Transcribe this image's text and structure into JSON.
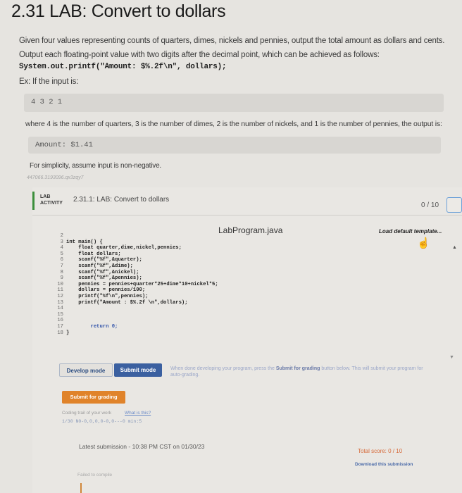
{
  "page": {
    "title": "2.31 LAB: Convert to dollars"
  },
  "description": {
    "line1": "Given four values representing counts of quarters, dimes, nickels and pennies, output the total amount as dollars and cents.",
    "line2": "Output each floating-point value with two digits after the decimal point, which can be achieved as follows:",
    "code_sample": "System.out.printf(\"Amount: $%.2f\\n\", dollars);",
    "example_intro": "Ex: If the input is:",
    "example_input": "4 3 2 1",
    "where_text": "where 4 is the number of quarters, 3 is the number of dimes, 2 is the number of nickels, and 1 is the number of pennies, the output is:",
    "example_output": "Amount: $1.41",
    "simplicity": "For simplicity, assume input is non-negative.",
    "hash_id": "447066.3193096.qx3zqy7"
  },
  "activity": {
    "badge_line1": "LAB",
    "badge_line2": "ACTIVITY",
    "title": "2.31.1: LAB: Convert to dollars",
    "score": "0 / 10"
  },
  "editor": {
    "file_name": "LabProgram.java",
    "load_default": "Load default template...",
    "lines": [
      {
        "n": "2",
        "code": ""
      },
      {
        "n": "3",
        "code": "int main() {"
      },
      {
        "n": "4",
        "code": "    float quarter,dime,nickel,pennies;"
      },
      {
        "n": "5",
        "code": "    float dollars;"
      },
      {
        "n": "6",
        "code": "    scanf(\"%f\",&quarter);"
      },
      {
        "n": "7",
        "code": "    scanf(\"%f\",&dime);"
      },
      {
        "n": "8",
        "code": "    scanf(\"%f\",&nickel);"
      },
      {
        "n": "9",
        "code": "    scanf(\"%f\",&pennies);"
      },
      {
        "n": "10",
        "code": "    pennies = pennies+quarter*25+dime*10+nickel*5;"
      },
      {
        "n": "11",
        "code": "    dollars = pennies/100;"
      },
      {
        "n": "12",
        "code": "    printf(\"%f\\n\",pennies);"
      },
      {
        "n": "13",
        "code": "    printf(\"Amount : $%.2f \\n\",dollars);"
      },
      {
        "n": "14",
        "code": ""
      },
      {
        "n": "15",
        "code": ""
      },
      {
        "n": "16",
        "code": ""
      },
      {
        "n": "17",
        "code": "        return 0;"
      },
      {
        "n": "18",
        "code": "}"
      }
    ]
  },
  "tabs": {
    "develop": "Develop mode",
    "submit": "Submit mode"
  },
  "submit_hint": {
    "prefix": "When done developing your program, press the ",
    "bold": "Submit for grading",
    "suffix": " button below. This will submit your program for auto-grading."
  },
  "grading": {
    "button": "Submit for grading",
    "trail_label": "Coding trail of your work",
    "whats_this": "What is this?",
    "trail_data": "1/30 N0-0,0,0,0-0,0---0 min:5",
    "latest": "Latest submission - 10:38 PM CST on 01/30/23",
    "total_score": "Total score: 0 / 10",
    "download": "Download this submission",
    "failed": "Failed to compile"
  },
  "icons": {
    "hand": "hand-pointer-icon",
    "caret_up": "caret-up-icon",
    "caret_down": "caret-down-icon"
  },
  "colors": {
    "badge_accent": "#3c8f3c",
    "submit_tab": "#3b60a0",
    "submit_button": "#e0832a",
    "total_score": "#d66a3a"
  }
}
